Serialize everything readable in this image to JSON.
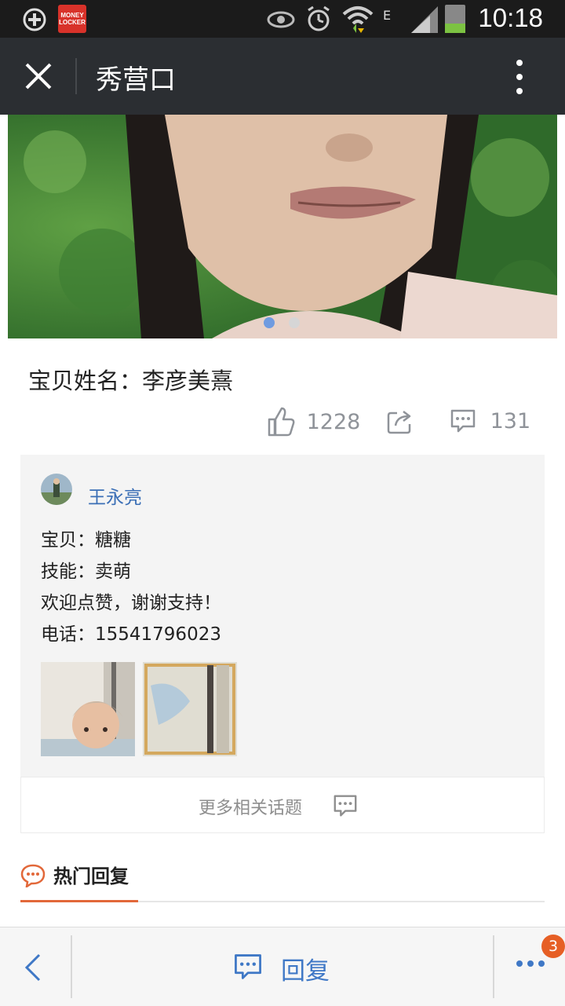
{
  "status_bar": {
    "time": "10:18",
    "network_type": "E",
    "app_badge": "MONEY LOCKER",
    "icons": [
      "add-circle-icon",
      "money-locker-icon",
      "eye-icon",
      "alarm-icon",
      "wifi-icon",
      "signal-icon",
      "battery-icon"
    ]
  },
  "titlebar": {
    "title": "秀营口"
  },
  "hero": {
    "page_count": 2,
    "active_index": 0
  },
  "post": {
    "baby_name": "宝贝姓名：李彦美熹",
    "likes": "1228",
    "comments": "131",
    "author": "王永亮",
    "lines": [
      "宝贝：糖糖",
      "技能：卖萌",
      "欢迎点赞，谢谢支持！",
      "电话：15541796023"
    ],
    "more_topics": "更多相关话题"
  },
  "hot_replies": {
    "label": "热门回复"
  },
  "bottom_bar": {
    "reply_label": "回复",
    "badge_count": "3"
  },
  "colors": {
    "accent_blue": "#3f78c6",
    "author_blue": "#3b6fb6",
    "hot_orange": "#e2683a",
    "badge_orange": "#e65f25",
    "titlebar_bg": "#2b2e32"
  }
}
